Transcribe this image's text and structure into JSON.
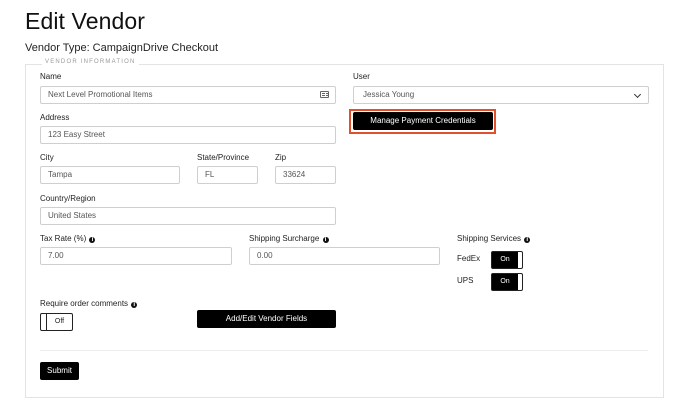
{
  "header": {
    "title": "Edit Vendor",
    "vendor_type": "Vendor Type: CampaignDrive Checkout"
  },
  "section": {
    "legend": "VENDOR INFORMATION"
  },
  "fields": {
    "name": {
      "label": "Name",
      "value": "Next Level Promotional Items"
    },
    "user": {
      "label": "User",
      "value": "Jessica Young"
    },
    "address": {
      "label": "Address",
      "value": "123 Easy Street"
    },
    "city": {
      "label": "City",
      "value": "Tampa"
    },
    "state": {
      "label": "State/Province",
      "value": "FL"
    },
    "zip": {
      "label": "Zip",
      "value": "33624"
    },
    "country": {
      "label": "Country/Region",
      "value": "United States"
    },
    "tax_rate": {
      "label": "Tax Rate (%)",
      "value": "7.00"
    },
    "shipping_surcharge": {
      "label": "Shipping Surcharge",
      "value": "0.00"
    }
  },
  "shipping_services": {
    "label": "Shipping Services",
    "items": [
      {
        "name": "FedEx",
        "state": "On"
      },
      {
        "name": "UPS",
        "state": "On"
      }
    ]
  },
  "require_comments": {
    "label": "Require order comments",
    "state": "Off"
  },
  "buttons": {
    "manage_credentials": "Manage Payment Credentials",
    "add_edit_fields": "Add/Edit Vendor Fields",
    "submit": "Submit"
  },
  "icons": {
    "info": "info-circle-icon",
    "card": "id-card-icon",
    "select": "chevron-down-icon"
  },
  "colors": {
    "accent_dark": "#000000",
    "highlight": "#e0502a"
  }
}
